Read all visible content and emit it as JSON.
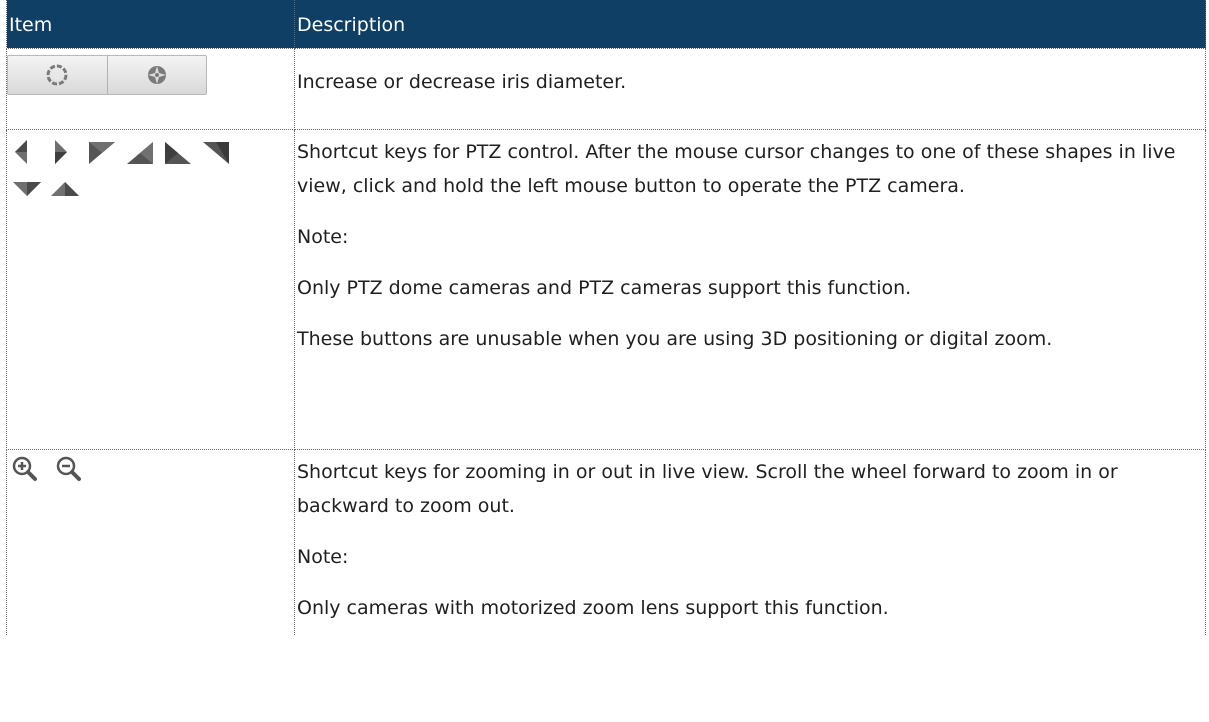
{
  "table": {
    "headers": {
      "item": "Item",
      "description": "Description"
    },
    "rows": {
      "iris": {
        "items": [
          "iris-open-icon",
          "iris-close-icon"
        ],
        "description": [
          "Increase or decrease iris diameter."
        ]
      },
      "ptz": {
        "items": [
          "arrow-left-icon",
          "arrow-right-icon",
          "arrow-up-left-icon",
          "arrow-down-left-icon",
          "arrow-down-right-icon",
          "arrow-up-right-icon",
          "arrow-down-icon",
          "arrow-up-icon"
        ],
        "description": [
          "Shortcut keys for PTZ control. After the mouse cursor changes to one of these shapes in live view, click and hold the left mouse button to operate the PTZ camera.",
          "Note:",
          "Only PTZ dome cameras and PTZ cameras support this function.",
          "These buttons are unusable when you are using 3D positioning or digital zoom."
        ]
      },
      "zoom": {
        "items": [
          "zoom-in-icon",
          "zoom-out-icon"
        ],
        "description": [
          "Shortcut keys for zooming in or out in live view. Scroll the wheel forward to zoom in or backward to zoom out.",
          "Note:",
          "Only cameras with motorized zoom lens support this function."
        ]
      }
    }
  },
  "colors": {
    "header_bg": "#0f3f64",
    "header_text": "#ffffff",
    "icon_dark": "#555555"
  }
}
